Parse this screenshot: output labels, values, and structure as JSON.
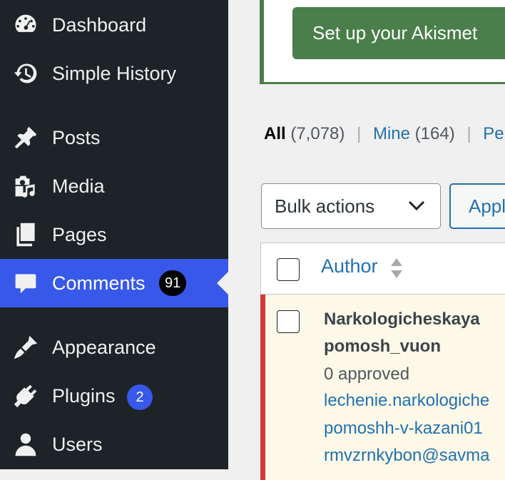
{
  "sidebar": {
    "items": [
      {
        "label": "Dashboard",
        "icon": "dashboard-icon"
      },
      {
        "label": "Simple History",
        "icon": "history-icon"
      },
      {
        "label": "Posts",
        "icon": "pushpin-icon"
      },
      {
        "label": "Media",
        "icon": "media-icon"
      },
      {
        "label": "Pages",
        "icon": "pages-icon"
      },
      {
        "label": "Comments",
        "icon": "comment-icon",
        "badge": "91",
        "active": true
      },
      {
        "label": "Appearance",
        "icon": "paintbrush-icon"
      },
      {
        "label": "Plugins",
        "icon": "plug-icon",
        "badge": "2"
      },
      {
        "label": "Users",
        "icon": "user-icon"
      }
    ]
  },
  "notice": {
    "button_label": "Set up your Akismet"
  },
  "filters": {
    "all_label": "All",
    "all_count": "(7,078)",
    "mine_label": "Mine",
    "mine_count": "(164)",
    "pending_label": "Pe",
    "separator": "|"
  },
  "bulk_actions": {
    "selected": "Bulk actions",
    "apply_label": "Apply"
  },
  "table": {
    "author_header": "Author",
    "rows": [
      {
        "name_line1": "Narkologicheskaya",
        "name_line2": "pomosh_vuon",
        "approved": "0 approved",
        "url_line1": "lechenie.narkologiche",
        "url_line2": "pomoshh-v-kazani01",
        "email": "rmvzrnkybon@savma"
      }
    ]
  },
  "colors": {
    "sidebar_bg": "#1d2327",
    "active_bg": "#3858e9",
    "akismet_green": "#4a7e4a",
    "link_blue": "#2271b1",
    "unapproved_border": "#d63638",
    "unapproved_bg": "#fcf9e8"
  }
}
